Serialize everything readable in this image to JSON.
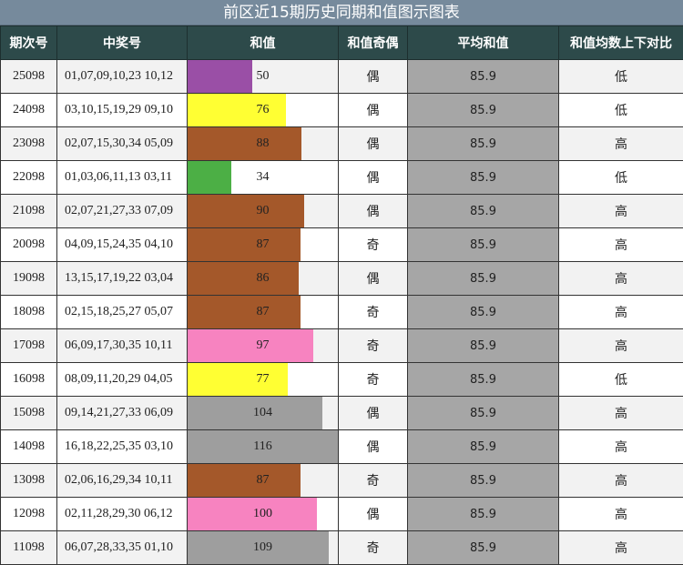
{
  "title": "前区近15期历史同期和值图示图表",
  "headers": [
    "期次号",
    "中奖号",
    "和值",
    "和值奇偶",
    "平均和值",
    "和值均数上下对比"
  ],
  "colors": {
    "header_bg": "#2d4a4a",
    "title_bg": "#768a9c",
    "avg_bg": "#a6a6a6",
    "bar_purple": "#9a4fa6",
    "bar_yellow": "#ffff33",
    "bar_brown": "#a4582a",
    "bar_green": "#4caf45",
    "bar_pink": "#f783c0",
    "bar_gray": "#9e9e9e"
  },
  "chart_data": {
    "type": "table",
    "title": "前区近15期历史同期和值图示图表",
    "bar_max": 116,
    "rows": [
      {
        "period": "25098",
        "numbers": "01,07,09,10,23 10,12",
        "sum": 50,
        "bar_color": "#9a4fa6",
        "parity": "偶",
        "avg": "85.9",
        "compare": "低"
      },
      {
        "period": "24098",
        "numbers": "03,10,15,19,29 09,10",
        "sum": 76,
        "bar_color": "#ffff33",
        "parity": "偶",
        "avg": "85.9",
        "compare": "低"
      },
      {
        "period": "23098",
        "numbers": "02,07,15,30,34 05,09",
        "sum": 88,
        "bar_color": "#a4582a",
        "parity": "偶",
        "avg": "85.9",
        "compare": "高"
      },
      {
        "period": "22098",
        "numbers": "01,03,06,11,13 03,11",
        "sum": 34,
        "bar_color": "#4caf45",
        "parity": "偶",
        "avg": "85.9",
        "compare": "低"
      },
      {
        "period": "21098",
        "numbers": "02,07,21,27,33 07,09",
        "sum": 90,
        "bar_color": "#a4582a",
        "parity": "偶",
        "avg": "85.9",
        "compare": "高"
      },
      {
        "period": "20098",
        "numbers": "04,09,15,24,35 04,10",
        "sum": 87,
        "bar_color": "#a4582a",
        "parity": "奇",
        "avg": "85.9",
        "compare": "高"
      },
      {
        "period": "19098",
        "numbers": "13,15,17,19,22 03,04",
        "sum": 86,
        "bar_color": "#a4582a",
        "parity": "偶",
        "avg": "85.9",
        "compare": "高"
      },
      {
        "period": "18098",
        "numbers": "02,15,18,25,27 05,07",
        "sum": 87,
        "bar_color": "#a4582a",
        "parity": "奇",
        "avg": "85.9",
        "compare": "高"
      },
      {
        "period": "17098",
        "numbers": "06,09,17,30,35 10,11",
        "sum": 97,
        "bar_color": "#f783c0",
        "parity": "奇",
        "avg": "85.9",
        "compare": "高"
      },
      {
        "period": "16098",
        "numbers": "08,09,11,20,29 04,05",
        "sum": 77,
        "bar_color": "#ffff33",
        "parity": "奇",
        "avg": "85.9",
        "compare": "低"
      },
      {
        "period": "15098",
        "numbers": "09,14,21,27,33 06,09",
        "sum": 104,
        "bar_color": "#9e9e9e",
        "parity": "偶",
        "avg": "85.9",
        "compare": "高"
      },
      {
        "period": "14098",
        "numbers": "16,18,22,25,35 03,10",
        "sum": 116,
        "bar_color": "#9e9e9e",
        "parity": "偶",
        "avg": "85.9",
        "compare": "高"
      },
      {
        "period": "13098",
        "numbers": "02,06,16,29,34 10,11",
        "sum": 87,
        "bar_color": "#a4582a",
        "parity": "奇",
        "avg": "85.9",
        "compare": "高"
      },
      {
        "period": "12098",
        "numbers": "02,11,28,29,30 06,12",
        "sum": 100,
        "bar_color": "#f783c0",
        "parity": "偶",
        "avg": "85.9",
        "compare": "高"
      },
      {
        "period": "11098",
        "numbers": "06,07,28,33,35 01,10",
        "sum": 109,
        "bar_color": "#9e9e9e",
        "parity": "奇",
        "avg": "85.9",
        "compare": "高"
      }
    ]
  }
}
